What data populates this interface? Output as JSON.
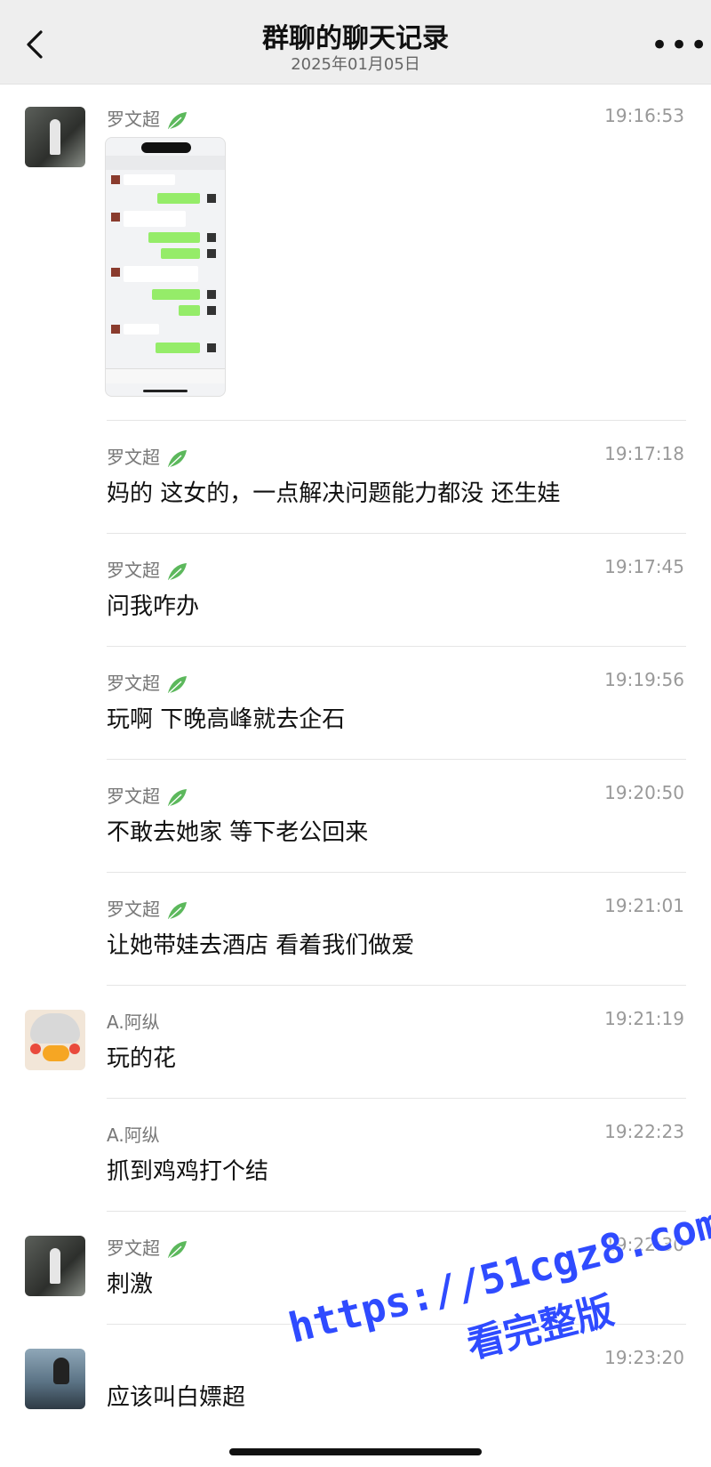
{
  "header": {
    "title": "群聊的聊天记录",
    "date": "2025年01月05日"
  },
  "icons": {
    "back": "chevron-left-icon",
    "more": "more-icon",
    "leaf": "leaf-icon"
  },
  "colors": {
    "header_bg": "#eeeeee",
    "bubble_green": "#95ec69",
    "watermark": "#2f4bff"
  },
  "messages": [
    {
      "name": "罗文超",
      "time": "19:16:53",
      "text": "",
      "type": "image"
    },
    {
      "name": "罗文超",
      "time": "19:17:18",
      "text": "妈的  这女的，一点解决问题能力都没   还生娃"
    },
    {
      "name": "罗文超",
      "time": "19:17:45",
      "text": "问我咋办"
    },
    {
      "name": "罗文超",
      "time": "19:19:56",
      "text": "玩啊  下晚高峰就去企石"
    },
    {
      "name": "罗文超",
      "time": "19:20:50",
      "text": "不敢去她家  等下老公回来"
    },
    {
      "name": "罗文超",
      "time": "19:21:01",
      "text": "让她带娃去酒店  看着我们做爱"
    },
    {
      "name": "A.阿纵",
      "time": "19:21:19",
      "text": "玩的花"
    },
    {
      "name": "A.阿纵",
      "time": "19:22:23",
      "text": "抓到鸡鸡打个结"
    },
    {
      "name": "罗文超",
      "time": "19:22:30",
      "text": "刺激"
    },
    {
      "name": "",
      "time": "19:23:20",
      "text": "应该叫白嫖超"
    }
  ],
  "watermark": {
    "url": "https://51cgz8.com",
    "tagline": "看完整版"
  }
}
